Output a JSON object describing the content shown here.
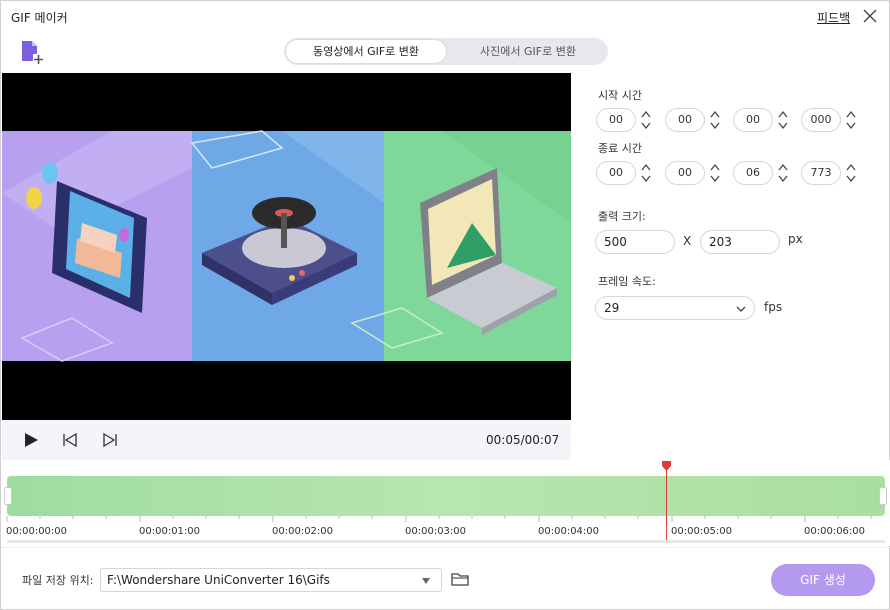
{
  "window": {
    "title": "GIF 메이커",
    "feedback_label": "피드백"
  },
  "icons": {
    "close": "close-icon",
    "add_file": "add-file-icon",
    "play": "play-icon",
    "prev": "previous-frame-icon",
    "next": "next-frame-icon",
    "folder": "folder-icon",
    "dropdown": "chevron-down-icon",
    "spin": "up-down-arrows-icon"
  },
  "mode": {
    "video_tab": "동영상에서 GIF로 변환",
    "photo_tab": "사진에서 GIF로 변환",
    "active": "video_tab"
  },
  "player": {
    "time": "00:05/00:07"
  },
  "settings": {
    "start_label": "시작 시간",
    "start": [
      "00",
      "00",
      "00",
      "000"
    ],
    "end_label": "종료 시간",
    "end": [
      "00",
      "00",
      "06",
      "773"
    ],
    "size_label": "출력 크기:",
    "width": "500",
    "separator": "X",
    "height": "203",
    "size_unit": "px",
    "fps_label": "프레임 속도:",
    "fps_value": "29",
    "fps_unit": "fps"
  },
  "timeline": {
    "ticks": [
      "00:00:00:00",
      "00:00:01:00",
      "00:00:02:00",
      "00:00:03:00",
      "00:00:04:00",
      "00:00:05:00",
      "00:00:06:00"
    ],
    "playhead_seconds": 5.0
  },
  "footer": {
    "save_label": "파일 저장 위치:",
    "save_path": "F:\\Wondershare UniConverter 16\\Gifs",
    "create_button": "GIF 생성"
  },
  "colors": {
    "accent": "#b49aef",
    "playhead": "#e03b3b",
    "track": "#a9df9e"
  }
}
